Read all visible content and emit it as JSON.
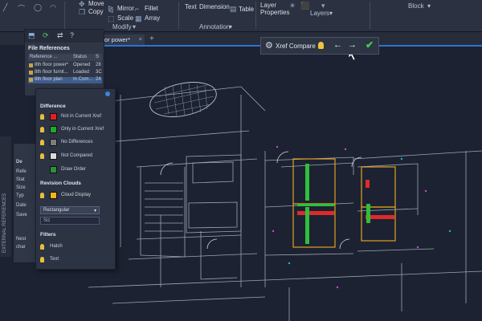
{
  "ribbon": {
    "modify": {
      "move": "Move",
      "copy": "Copy",
      "mirror": "Mirror",
      "fillet": "Fillet",
      "scale": "Scale",
      "array": "Array",
      "panel": "Modify"
    },
    "annotation": {
      "text": "Text",
      "dimension": "Dimension",
      "table": "Table",
      "panel": "Annotation"
    },
    "layers": {
      "layer_properties": "Layer\nProperties",
      "panel": "Layers"
    },
    "block": {
      "panel": "Block"
    }
  },
  "document_tab": {
    "label": "floor power*",
    "close": "×",
    "new_tab": "+"
  },
  "xref_compare_bar": {
    "label": "Xref Compare",
    "prev": "←",
    "next": "→",
    "accept": "✔"
  },
  "external_references": {
    "section_title": "File References",
    "columns": [
      "Reference ...",
      "Status",
      "S"
    ],
    "rows": [
      {
        "name": "8th floor power*",
        "status": "Opened",
        "size": "28",
        "selected": false
      },
      {
        "name": "8th floor furnit...",
        "status": "Loaded",
        "size": "3C",
        "selected": false
      },
      {
        "name": "8th floor plan",
        "status": "In Com...",
        "size": "24",
        "selected": true
      }
    ],
    "vertical_title": "EXTERNAL REFERENCES"
  },
  "details": {
    "labels": [
      "De",
      "Refe",
      "Stat",
      "Size",
      "Typ",
      "Date",
      "Save",
      "Nest",
      "char"
    ]
  },
  "compare_settings": {
    "difference_title": "Difference",
    "difference_items": [
      {
        "label": "Not in Current Xref",
        "color": "#e02020"
      },
      {
        "label": "Only in Current Xref",
        "color": "#1fa82e"
      },
      {
        "label": "No Differences",
        "color": "#7d7d7d"
      },
      {
        "label": "Not Compared",
        "color": "#d9d9d9"
      },
      {
        "label": "Draw Order",
        "color": "#2c8f3b"
      }
    ],
    "revision_title": "Revision Clouds",
    "cloud_display": {
      "label": "Cloud Display",
      "color": "#f2b51a"
    },
    "shape_select": "Rectangular",
    "size_field": "Siz",
    "filters_title": "Filters",
    "filters": [
      {
        "label": "Hatch"
      },
      {
        "label": "Text"
      }
    ]
  },
  "colors": {
    "accent": "#2b73d6",
    "ribbon_bg": "#2b3140",
    "drawing_bg": "#1c2231",
    "accept_green": "#3ed05a"
  }
}
